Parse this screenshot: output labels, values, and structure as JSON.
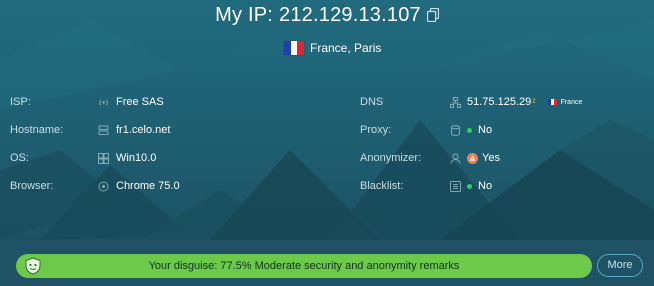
{
  "header": {
    "ip_label": "My IP:",
    "ip_value": "212.129.13.107",
    "location": "France, Paris"
  },
  "details": {
    "isp": {
      "label": "ISP:",
      "value": "Free SAS"
    },
    "hostname": {
      "label": "Hostname:",
      "value": "fr1.celo.net"
    },
    "os": {
      "label": "OS:",
      "value": "Win10.0"
    },
    "browser": {
      "label": "Browser:",
      "value": "Chrome 75.0"
    },
    "dns": {
      "label": "DNS",
      "value": "51.75.125.29",
      "sup": "2",
      "country": "France"
    },
    "proxy": {
      "label": "Proxy:",
      "value": "No"
    },
    "anonymizer": {
      "label": "Anonymizer:",
      "value": "Yes"
    },
    "blacklist": {
      "label": "Blacklist:",
      "value": "No"
    }
  },
  "disguise": {
    "text": "Your disguise: 77.5% Moderate security and anonymity remarks",
    "more_label": "More"
  },
  "colors": {
    "background": "#1f5566",
    "ok_dot": "#2fd25b",
    "warning": "#f08050",
    "disguise_bar": "#6dc94a"
  },
  "icons": {
    "copy": "copy-icon",
    "isp": "wifi-icon",
    "hostname": "server-icon",
    "os": "windows-icon",
    "browser": "globe-icon",
    "dns": "network-icon",
    "proxy": "database-icon",
    "anonymizer": "user-mask-icon",
    "blacklist": "list-icon",
    "disguise": "mask-shield-icon"
  }
}
